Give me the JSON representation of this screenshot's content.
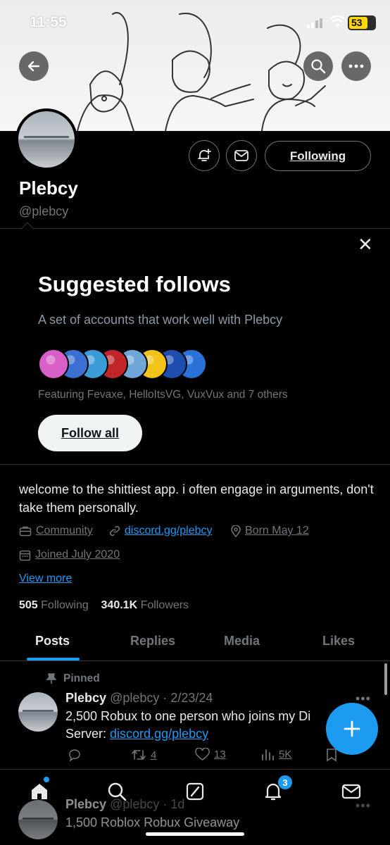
{
  "status_bar": {
    "time": "11:55",
    "battery": "53"
  },
  "profile": {
    "name": "Plebcy",
    "handle": "@plebcy",
    "following_button": "Following"
  },
  "suggested": {
    "title": "Suggested follows",
    "subtitle": "A set of accounts that work well with Plebcy",
    "featuring": "Featuring Fevaxe, HelloItsVG, VuxVux and 7 others",
    "follow_all": "Follow all",
    "face_colors": [
      "#d95fc8",
      "#3b6fd1",
      "#3a9bd6",
      "#c2252a",
      "#6fa7d8",
      "#f2c318",
      "#1f4fae",
      "#2a72d8"
    ]
  },
  "bio": {
    "text": "welcome to the shittiest app. i often engage in arguments, don't take them personally.",
    "category": "Community",
    "link": "discord.gg/plebcy",
    "born": "Born May 12",
    "joined": "Joined July 2020",
    "view_more": "View more"
  },
  "stats": {
    "following_count": "505",
    "following_label": "Following",
    "followers_count": "340.1K",
    "followers_label": "Followers"
  },
  "tabs": [
    "Posts",
    "Replies",
    "Media",
    "Likes"
  ],
  "pinned_post": {
    "pinned_label": "Pinned",
    "author": "Plebcy",
    "meta": "@plebcy · 2/23/24",
    "text_line1": "2,500 Robux to one person who joins my Di",
    "text_line2_prefix": "Server: ",
    "text_link": "discord.gg/plebcy",
    "reposts": "4",
    "likes": "13",
    "views": "5K"
  },
  "second_post": {
    "author": "Plebcy",
    "meta": "@plebcy · 1d",
    "text": "1,500 Roblox Robux Giveaway"
  },
  "nav": {
    "notifications_badge": "3"
  },
  "icons": {
    "back": "back-arrow-icon",
    "search": "search-icon",
    "more": "more-icon",
    "bell": "bell-plus-icon",
    "mail": "mail-icon",
    "briefcase": "briefcase-icon",
    "link": "link-icon",
    "location": "location-icon",
    "calendar": "calendar-icon",
    "pin": "pin-icon",
    "home": "home-icon",
    "compose": "compose-icon"
  },
  "colors": {
    "accent": "#1d9bf0",
    "background": "#000000",
    "muted": "#71767b"
  }
}
